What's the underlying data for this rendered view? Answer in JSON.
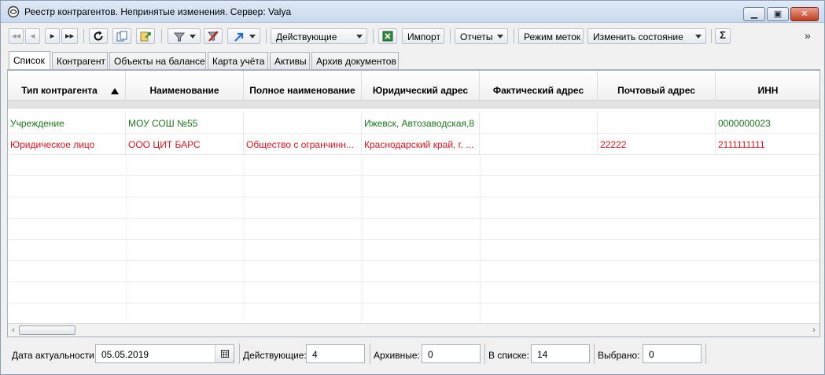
{
  "window": {
    "title": "Реестр контрагентов. Непринятые изменения. Сервер: Valya"
  },
  "toolbar": {
    "status_filter": "Действующие",
    "import_label": "Импорт",
    "reports_label": "Отчеты",
    "tag_mode_label": "Режим меток",
    "change_state_label": "Изменить состояние",
    "overflow": "»"
  },
  "tabs": [
    {
      "label": "Список",
      "active": true
    },
    {
      "label": "Контрагент"
    },
    {
      "label": "Объекты на балансе"
    },
    {
      "label": "Карта учёта"
    },
    {
      "label": "Активы"
    },
    {
      "label": "Архив документов"
    }
  ],
  "grid": {
    "columns": [
      "Тип контрагента",
      "Наименование",
      "Полное наименование",
      "Юридический адрес",
      "Фактический адрес",
      "Почтовый адрес",
      "ИНН"
    ],
    "sort_column": "Тип контрагента",
    "sort_direction": "ascending",
    "rows": [
      {
        "status": "green",
        "cells": [
          "Учреждение",
          "МОУ СОШ №55",
          "",
          "Ижевск, Автозаводская,8",
          "",
          "",
          "0000000023"
        ]
      },
      {
        "status": "red",
        "cells": [
          "Юридическое лицо",
          "ООО ЦИТ БАРС",
          "Общество с огранчинн...",
          "Краснодарский край, г. ...",
          "",
          "22222",
          "2111111111"
        ]
      }
    ]
  },
  "colors": {
    "ok_row": "#1a7a1a",
    "error_row": "#e0141e"
  },
  "status": {
    "date_label": "Дата актуальности",
    "date_value": "05.05.2019",
    "active_label": "Действующие:",
    "active_value": "4",
    "archived_label": "Архивные:",
    "archived_value": "0",
    "in_list_label": "В списке:",
    "in_list_value": "14",
    "selected_label": "Выбрано:",
    "selected_value": "0"
  }
}
